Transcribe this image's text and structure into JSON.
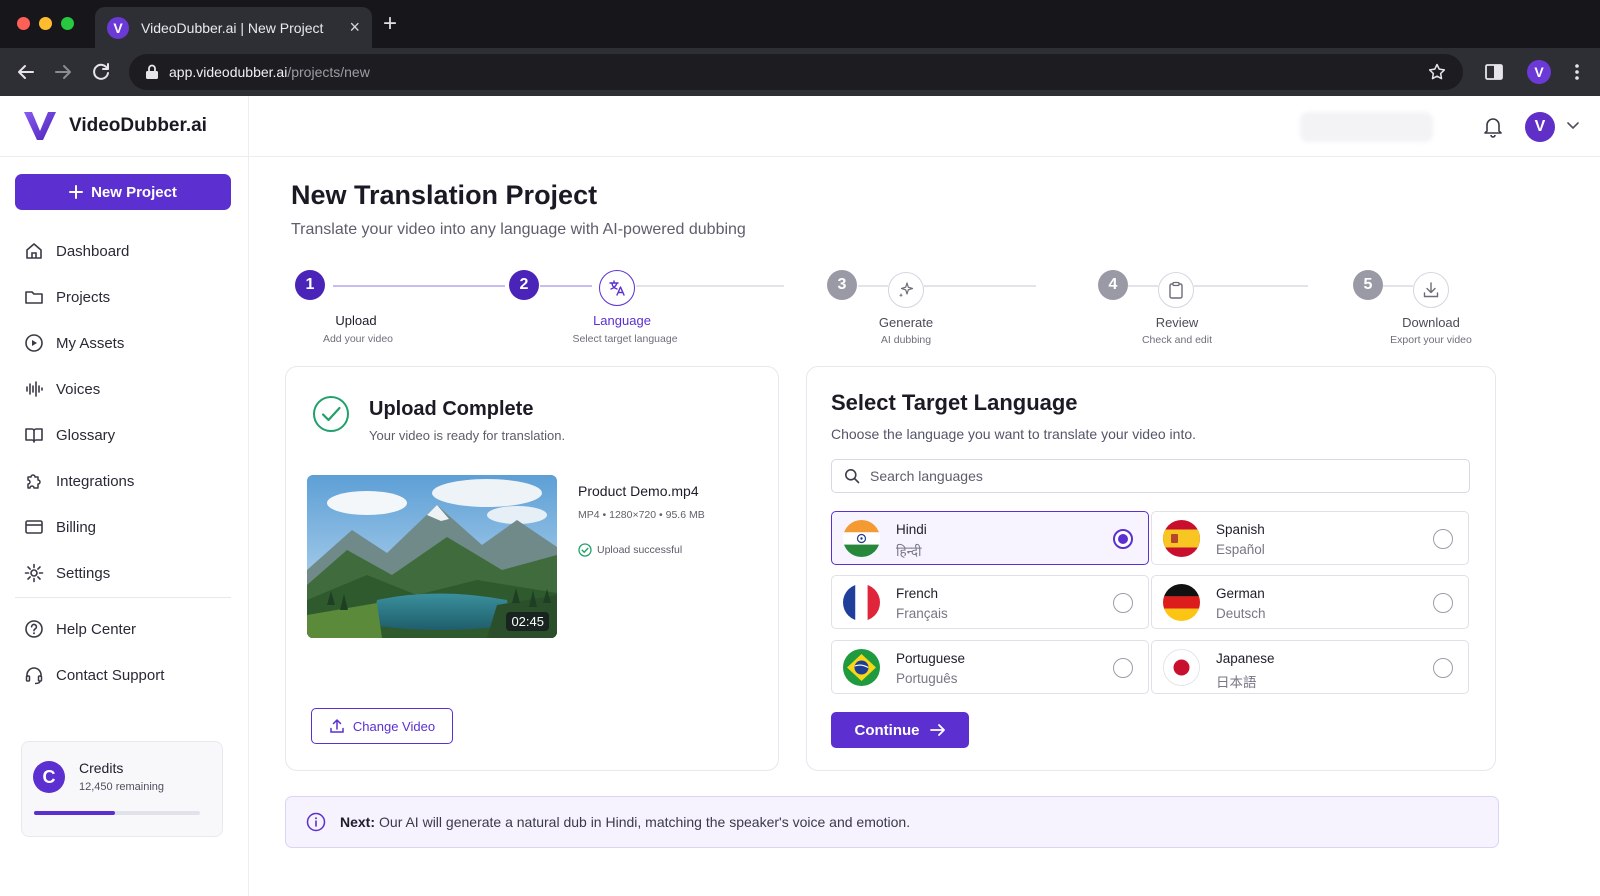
{
  "browser": {
    "tab_title": "VideoDubber.ai | New Project",
    "tab_favicon": "V",
    "url_host": "app.videodubber.ai",
    "url_path": "/projects/new",
    "profile_initial": "V"
  },
  "app": {
    "brand": "VideoDubber.ai",
    "user_initial": "V",
    "accent_color": "#5b2fd0"
  },
  "sidebar": {
    "new_project_label": "New Project",
    "items": [
      {
        "label": "Dashboard",
        "icon": "home-icon"
      },
      {
        "label": "Projects",
        "icon": "folder-icon"
      },
      {
        "label": "My Assets",
        "icon": "play-circle-icon"
      },
      {
        "label": "Voices",
        "icon": "waveform-icon"
      },
      {
        "label": "Glossary",
        "icon": "book-icon"
      },
      {
        "label": "Integrations",
        "icon": "puzzle-icon"
      },
      {
        "label": "Billing",
        "icon": "card-icon"
      },
      {
        "label": "Settings",
        "icon": "gear-icon"
      }
    ],
    "support_items": [
      {
        "label": "Help Center",
        "icon": "help-icon"
      },
      {
        "label": "Contact Support",
        "icon": "headset-icon"
      }
    ],
    "credits": {
      "title": "Credits",
      "remaining": "12,450 remaining",
      "progress": 0.49
    }
  },
  "page": {
    "title": "New Translation Project",
    "subtitle": "Translate your video into any language with AI-powered dubbing"
  },
  "steps": [
    {
      "number": "1",
      "label": "Upload",
      "sub": "Add your video",
      "state": "done",
      "icon": "upload-icon"
    },
    {
      "number": "2",
      "label": "Language",
      "sub": "Select target language",
      "state": "active",
      "icon": "translate-icon"
    },
    {
      "number": "3",
      "label": "Generate",
      "sub": "AI dubbing",
      "state": "pending",
      "icon": "sparkle-icon"
    },
    {
      "number": "4",
      "label": "Review",
      "sub": "Check and edit",
      "state": "pending",
      "icon": "clipboard-icon"
    },
    {
      "number": "5",
      "label": "Download",
      "sub": "Export your video",
      "state": "pending",
      "icon": "download-icon"
    }
  ],
  "upload": {
    "title": "Upload Complete",
    "subtitle": "Your video is ready for translation.",
    "file_name": "Product Demo.mp4",
    "file_meta": "MP4 • 1280×720 • 95.6 MB",
    "status": "Upload successful",
    "duration": "02:45",
    "change_label": "Change Video"
  },
  "language": {
    "title": "Select Target Language",
    "subtitle": "Choose the language you want to translate your video into.",
    "search_placeholder": "Search languages",
    "options": [
      {
        "name": "Hindi",
        "native": "हिन्दी",
        "flag": "india-flag",
        "selected": true
      },
      {
        "name": "Spanish",
        "native": "Español",
        "flag": "spain-flag",
        "selected": false
      },
      {
        "name": "French",
        "native": "Français",
        "flag": "france-flag",
        "selected": false
      },
      {
        "name": "German",
        "native": "Deutsch",
        "flag": "germany-flag",
        "selected": false
      },
      {
        "name": "Portuguese",
        "native": "Português",
        "flag": "brazil-flag",
        "selected": false
      },
      {
        "name": "Japanese",
        "native": "日本語",
        "flag": "japan-flag",
        "selected": false
      }
    ],
    "continue_label": "Continue"
  },
  "info": {
    "label": "Next:",
    "text": "Our AI will generate a natural dub in Hindi, matching the speaker's voice and emotion."
  }
}
